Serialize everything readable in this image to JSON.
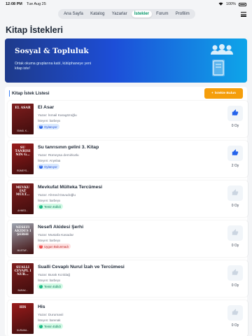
{
  "status": {
    "time": "12:08 PM",
    "date": "Tue Aug 25",
    "battery": "100%"
  },
  "nav": {
    "tabs": [
      "Ana Sayfa",
      "Katalog",
      "Yazarlar",
      "İstekler",
      "Forum",
      "Profilim"
    ],
    "active": "İstekler"
  },
  "page_title": "Kitap İstekleri",
  "banner": {
    "title": "Sosyal & Topluluk",
    "subtitle": "Ortak okuma gruplarına katıl, kütüphaneye yeni kitap iste!",
    "icons": [
      "group-icon",
      "book-icon"
    ]
  },
  "list": {
    "heading": "Kitap İstek Listesi",
    "add_label": "İstekte Bulun",
    "books": [
      {
        "title": "El Asar",
        "author": "Yazar: İsmail Karagözoğlu",
        "requester": "İsteyen: barbeyx",
        "status": "Oylanıyor",
        "status_kind": "voting",
        "votes": "0 Oy",
        "voted": true,
        "cover_title": "EL ASAR",
        "cover_author": "İSMAİL K...",
        "cover_color": "#7f1d1d"
      },
      {
        "title": "Su tanrısının gelini 3. Kitap",
        "author": "Yazar: Rümeysa demirkutlu",
        "requester": "İsteyen: Anyelaa",
        "status": "Oylanıyor",
        "status_kind": "voting",
        "votes": "2 Oy",
        "voted": true,
        "cover_title": "SU TANRISI NIN G...",
        "cover_author": "RÜMEYS...",
        "cover_color": "#991b1b"
      },
      {
        "title": "Mevkufat Mülteka Tercümesi",
        "author": "Yazar: Ahmed Davudoğlu",
        "requester": "İsteyen: barbeyx",
        "status": "Temin Edildi",
        "status_kind": "done",
        "votes": "0 Oy",
        "voted": false,
        "cover_title": "MEVKU FAT MÜLT...",
        "cover_author": "AHMED...",
        "cover_color": "#7f1d1d"
      },
      {
        "title": "Nesefi Akidesi Şerhi",
        "author": "Yazar: Mustafa Kasadar",
        "requester": "İsteyen: barbeyx",
        "status": "Uygun Bulunmadı",
        "status_kind": "rejected",
        "votes": "0 Oy",
        "voted": false,
        "cover_title": "NESEFI AKIDES I ŞERHI",
        "cover_author": "MUSTAF...",
        "cover_color": "#9ca3af"
      },
      {
        "title": "Sualli Cevaplı Nurul İzah ve Tercümesi",
        "author": "Yazar: Burak Kızıldağ",
        "requester": "İsteyen: barbeyx",
        "status": "Temin Edildi",
        "status_kind": "done",
        "votes": "0 Oy",
        "voted": false,
        "cover_title": "SUALLI CEVAPL I NUR...",
        "cover_author": "BURAK...",
        "cover_color": "#7f1d1d"
      },
      {
        "title": "His",
        "author": "Yazar: Durumavii",
        "requester": "İsteyen: barenak",
        "status": "Temin Edildi",
        "status_kind": "done",
        "votes": "0 Oy",
        "voted": false,
        "cover_title": "HIS",
        "cover_author": "DURUMA...",
        "cover_color": "#991b1b"
      }
    ]
  },
  "colors": {
    "accent": "#059669",
    "vote_active": "#2563eb",
    "vote_inactive": "#cbd5e1",
    "add_button": "#f59e0b",
    "banner_from": "#1e3a8a",
    "banner_to": "#0ea5e9"
  }
}
